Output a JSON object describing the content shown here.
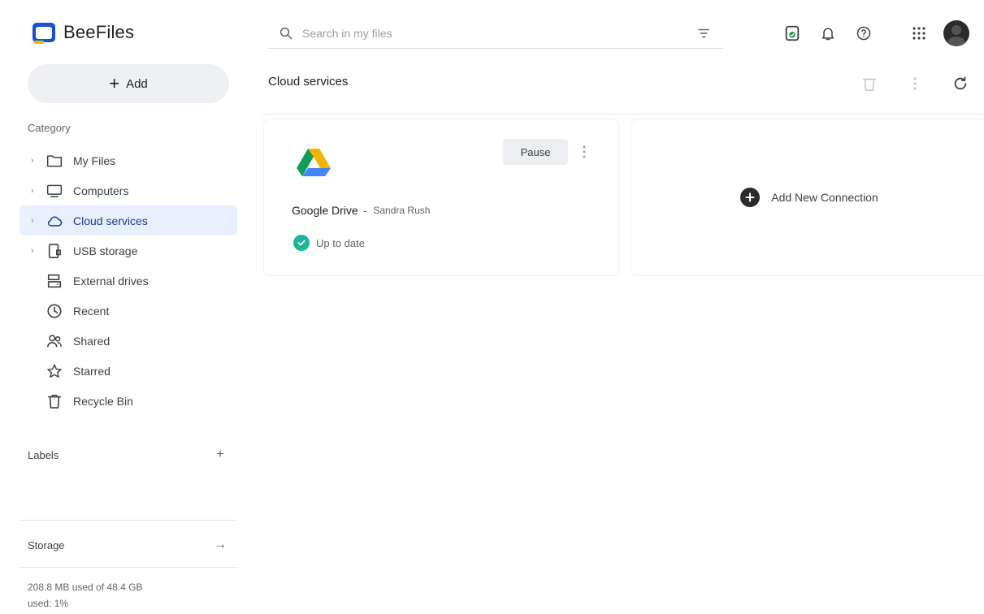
{
  "app": {
    "name": "BeeFiles"
  },
  "search": {
    "placeholder": "Search in my files"
  },
  "header": {
    "icons": [
      "sync-status-icon",
      "notifications-icon",
      "help-icon",
      "apps-grid-icon"
    ]
  },
  "sidebar": {
    "add_button_label": "Add",
    "category_heading": "Category",
    "items": [
      {
        "label": "My Files",
        "icon": "folder-icon",
        "expandable": true
      },
      {
        "label": "Computers",
        "icon": "computer-icon",
        "expandable": true
      },
      {
        "label": "Cloud services",
        "icon": "cloud-icon",
        "expandable": true,
        "active": true
      },
      {
        "label": "USB storage",
        "icon": "usb-storage-icon",
        "expandable": true
      },
      {
        "label": "External drives",
        "icon": "external-drive-icon",
        "expandable": false
      },
      {
        "label": "Recent",
        "icon": "clock-icon",
        "expandable": false
      },
      {
        "label": "Shared",
        "icon": "people-icon",
        "expandable": false
      },
      {
        "label": "Starred",
        "icon": "star-icon",
        "expandable": false
      },
      {
        "label": "Recycle Bin",
        "icon": "trash-icon",
        "expandable": false
      }
    ],
    "labels_heading": "Labels",
    "labels_add": "+",
    "storage_heading": "Storage",
    "storage_arrow": "→",
    "storage_used": "208.8 MB used of 48.4 GB",
    "storage_total": "used: 1%"
  },
  "main": {
    "title": "Cloud services",
    "toolbar_icons": [
      "delete-icon",
      "more-icon",
      "refresh-icon"
    ],
    "cards": [
      {
        "service": "Google Drive",
        "account": "Sandra Rush",
        "action_label": "Pause",
        "status": "Up to date"
      }
    ],
    "add_connection_label": "Add New Connection"
  },
  "colors": {
    "accent": "#1a4fd6",
    "active_nav_bg": "#e8f0fe",
    "status_ok": "#1fb59a",
    "header_badge": "#1e8e3e"
  }
}
